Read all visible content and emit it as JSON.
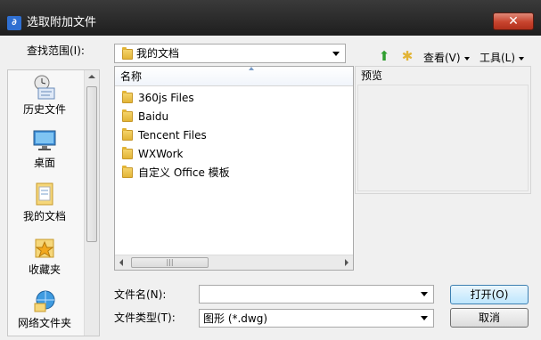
{
  "window": {
    "title": "选取附加文件",
    "close_label": "✕"
  },
  "lookin": {
    "label": "查找范围(I):",
    "value": "我的文档"
  },
  "toolbar": {
    "view_label": "查看(V)",
    "tools_label": "工具(L)"
  },
  "places": [
    {
      "label": "历史文件",
      "icon": "history-icon"
    },
    {
      "label": "桌面",
      "icon": "desktop-icon"
    },
    {
      "label": "我的文档",
      "icon": "documents-icon"
    },
    {
      "label": "收藏夹",
      "icon": "favorites-icon"
    },
    {
      "label": "网络文件夹",
      "icon": "network-folder-icon"
    }
  ],
  "filelist": {
    "column_name": "名称",
    "items": [
      "360js Files",
      "Baidu",
      "Tencent Files",
      "WXWork",
      "自定义 Office 模板"
    ]
  },
  "preview": {
    "label": "预览"
  },
  "filename": {
    "label": "文件名(N):",
    "value": ""
  },
  "filetype": {
    "label": "文件类型(T):",
    "value": "图形 (*.dwg)"
  },
  "buttons": {
    "open": "打开(O)",
    "cancel": "取消"
  },
  "colors": {
    "title_bar": "#1e1e1e",
    "close": "#c7432d",
    "folder": "#e2b436",
    "primary_button": "#bee6fd"
  }
}
